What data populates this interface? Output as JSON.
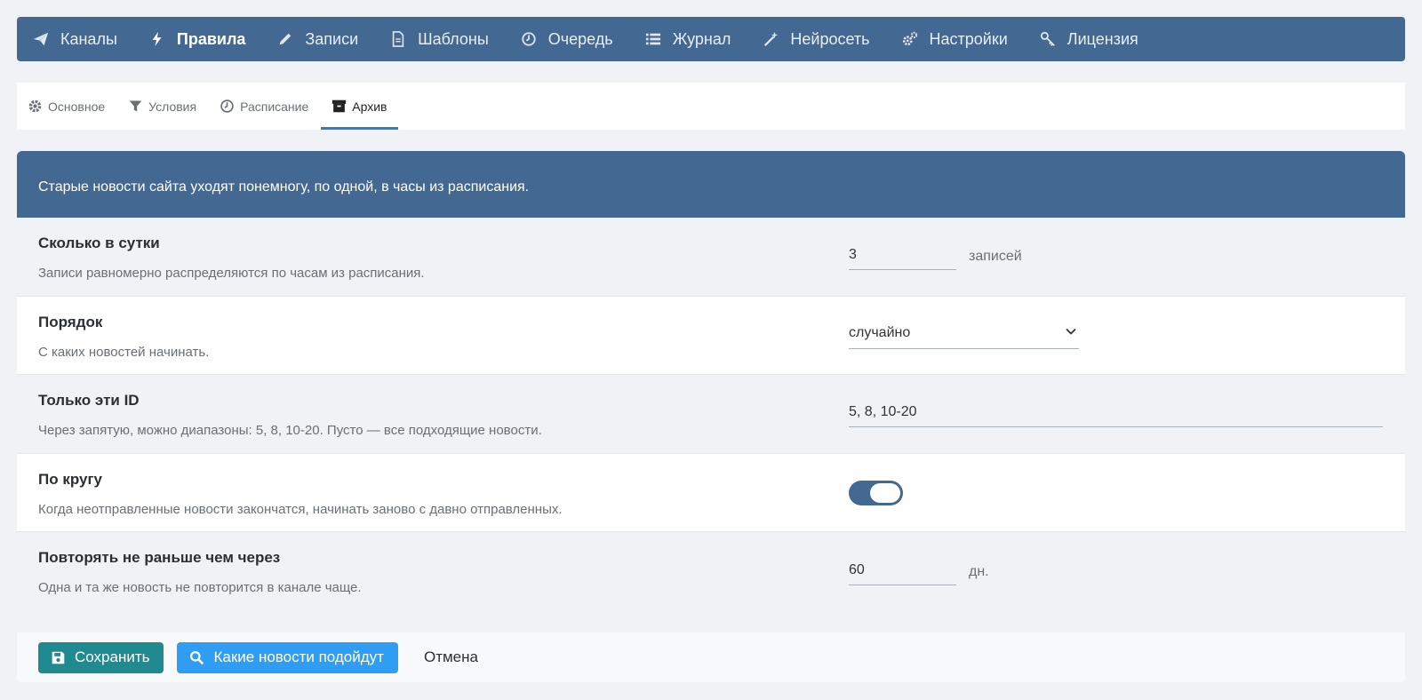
{
  "nav": {
    "items": [
      {
        "label": "Каналы",
        "icon": "paper-plane-icon"
      },
      {
        "label": "Правила",
        "icon": "bolt-icon",
        "active": true
      },
      {
        "label": "Записи",
        "icon": "pencil-icon"
      },
      {
        "label": "Шаблоны",
        "icon": "document-icon"
      },
      {
        "label": "Очередь",
        "icon": "clock-icon"
      },
      {
        "label": "Журнал",
        "icon": "list-icon"
      },
      {
        "label": "Нейросеть",
        "icon": "magic-wand-icon"
      },
      {
        "label": "Настройки",
        "icon": "gears-icon"
      },
      {
        "label": "Лицензия",
        "icon": "key-icon"
      }
    ]
  },
  "tabs": [
    {
      "label": "Основное",
      "icon": "gear-icon"
    },
    {
      "label": "Условия",
      "icon": "filter-icon"
    },
    {
      "label": "Расписание",
      "icon": "clock-icon"
    },
    {
      "label": "Архив",
      "icon": "archive-icon",
      "active": true
    }
  ],
  "banner": {
    "text": "Старые новости сайта уходят понемногу, по одной, в часы из расписания."
  },
  "settings": {
    "per_day": {
      "label": "Сколько в сутки",
      "description": "Записи равномерно распределяются по часам из расписания.",
      "value": "3",
      "unit": "записей"
    },
    "order": {
      "label": "Порядок",
      "description": "С каких новостей начинать.",
      "selected": "случайно"
    },
    "only_ids": {
      "label": "Только эти ID",
      "description": "Через запятую, можно диапазоны: 5, 8, 10-20. Пусто — все подходящие новости.",
      "value": "5, 8, 10-20"
    },
    "loop": {
      "label": "По кругу",
      "description": "Когда неотправленные новости закончатся, начинать заново с давно отправленных.",
      "enabled": true
    },
    "repeat_after": {
      "label": "Повторять не раньше чем через",
      "description": "Одна и та же новость не повторится в канале чаще.",
      "value": "60",
      "unit": "дн."
    }
  },
  "footer": {
    "save_label": "Сохранить",
    "check_label": "Какие новости подойдут",
    "cancel_label": "Отмена"
  },
  "colors": {
    "primary": "#436892",
    "save": "#1f8a8f",
    "check": "#2f9df2",
    "tab_accent": "#2f7bd0"
  }
}
